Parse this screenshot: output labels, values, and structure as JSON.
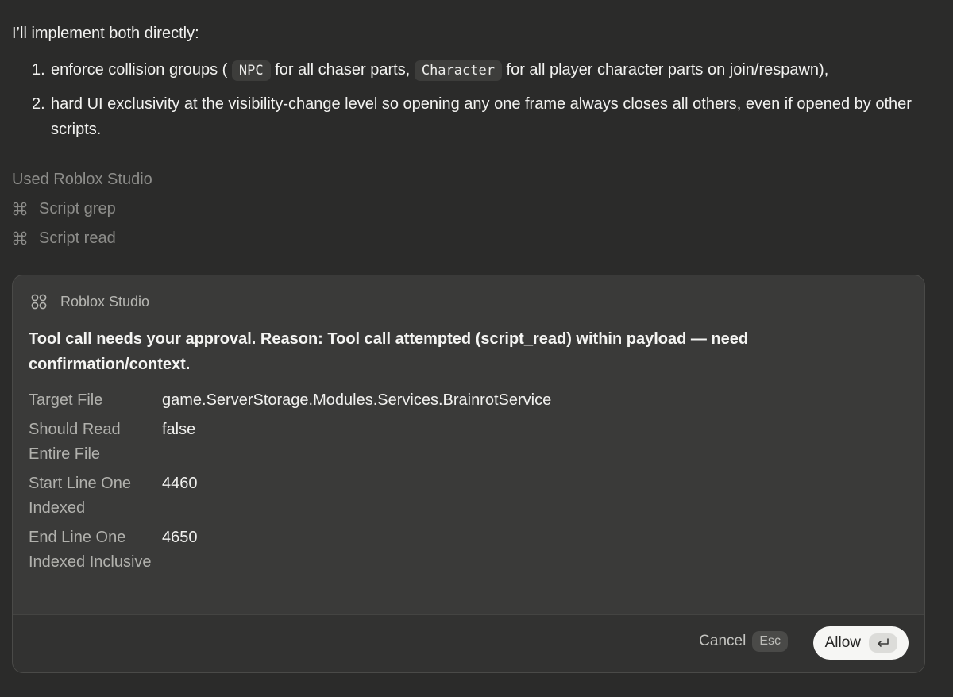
{
  "message": {
    "intro": "I’ll implement both directly:",
    "steps": [
      {
        "num": "1.",
        "parts": {
          "a": "enforce collision groups (",
          "code1": "NPC",
          "b": "for all chaser parts,",
          "code2": "Character",
          "c": "for all player character parts on join/respawn),"
        }
      },
      {
        "num": "2.",
        "text": "hard UI exclusivity at the visibility-change level so opening any one frame always closes all others, even if opened by other scripts."
      }
    ]
  },
  "tools": {
    "used_label": "Used Roblox Studio",
    "items": [
      {
        "label": "Script grep",
        "icon": "command-icon"
      },
      {
        "label": "Script read",
        "icon": "command-icon"
      }
    ]
  },
  "approval": {
    "app_name": "Roblox Studio",
    "app_icon": "four-circles-icon",
    "reason": "Tool call needs your approval. Reason: Tool call attempted (script_read) within payload — need confirmation/context.",
    "params": [
      {
        "key": "Target File",
        "value": "game.ServerStorage.Modules.Services.BrainrotService"
      },
      {
        "key": "Should Read Entire File",
        "value": "false"
      },
      {
        "key": "Start Line One Indexed",
        "value": "4460"
      },
      {
        "key": "End Line One Indexed Inclusive",
        "value": "4650"
      }
    ],
    "cancel_label": "Cancel",
    "cancel_shortcut": "Esc",
    "allow_label": "Allow",
    "allow_shortcut_icon": "return-key-icon"
  },
  "colors": {
    "background": "#2b2b2a",
    "card": "#3a3a39",
    "muted_text": "#8d8d8a",
    "allow_button": "#f6f6f4"
  }
}
